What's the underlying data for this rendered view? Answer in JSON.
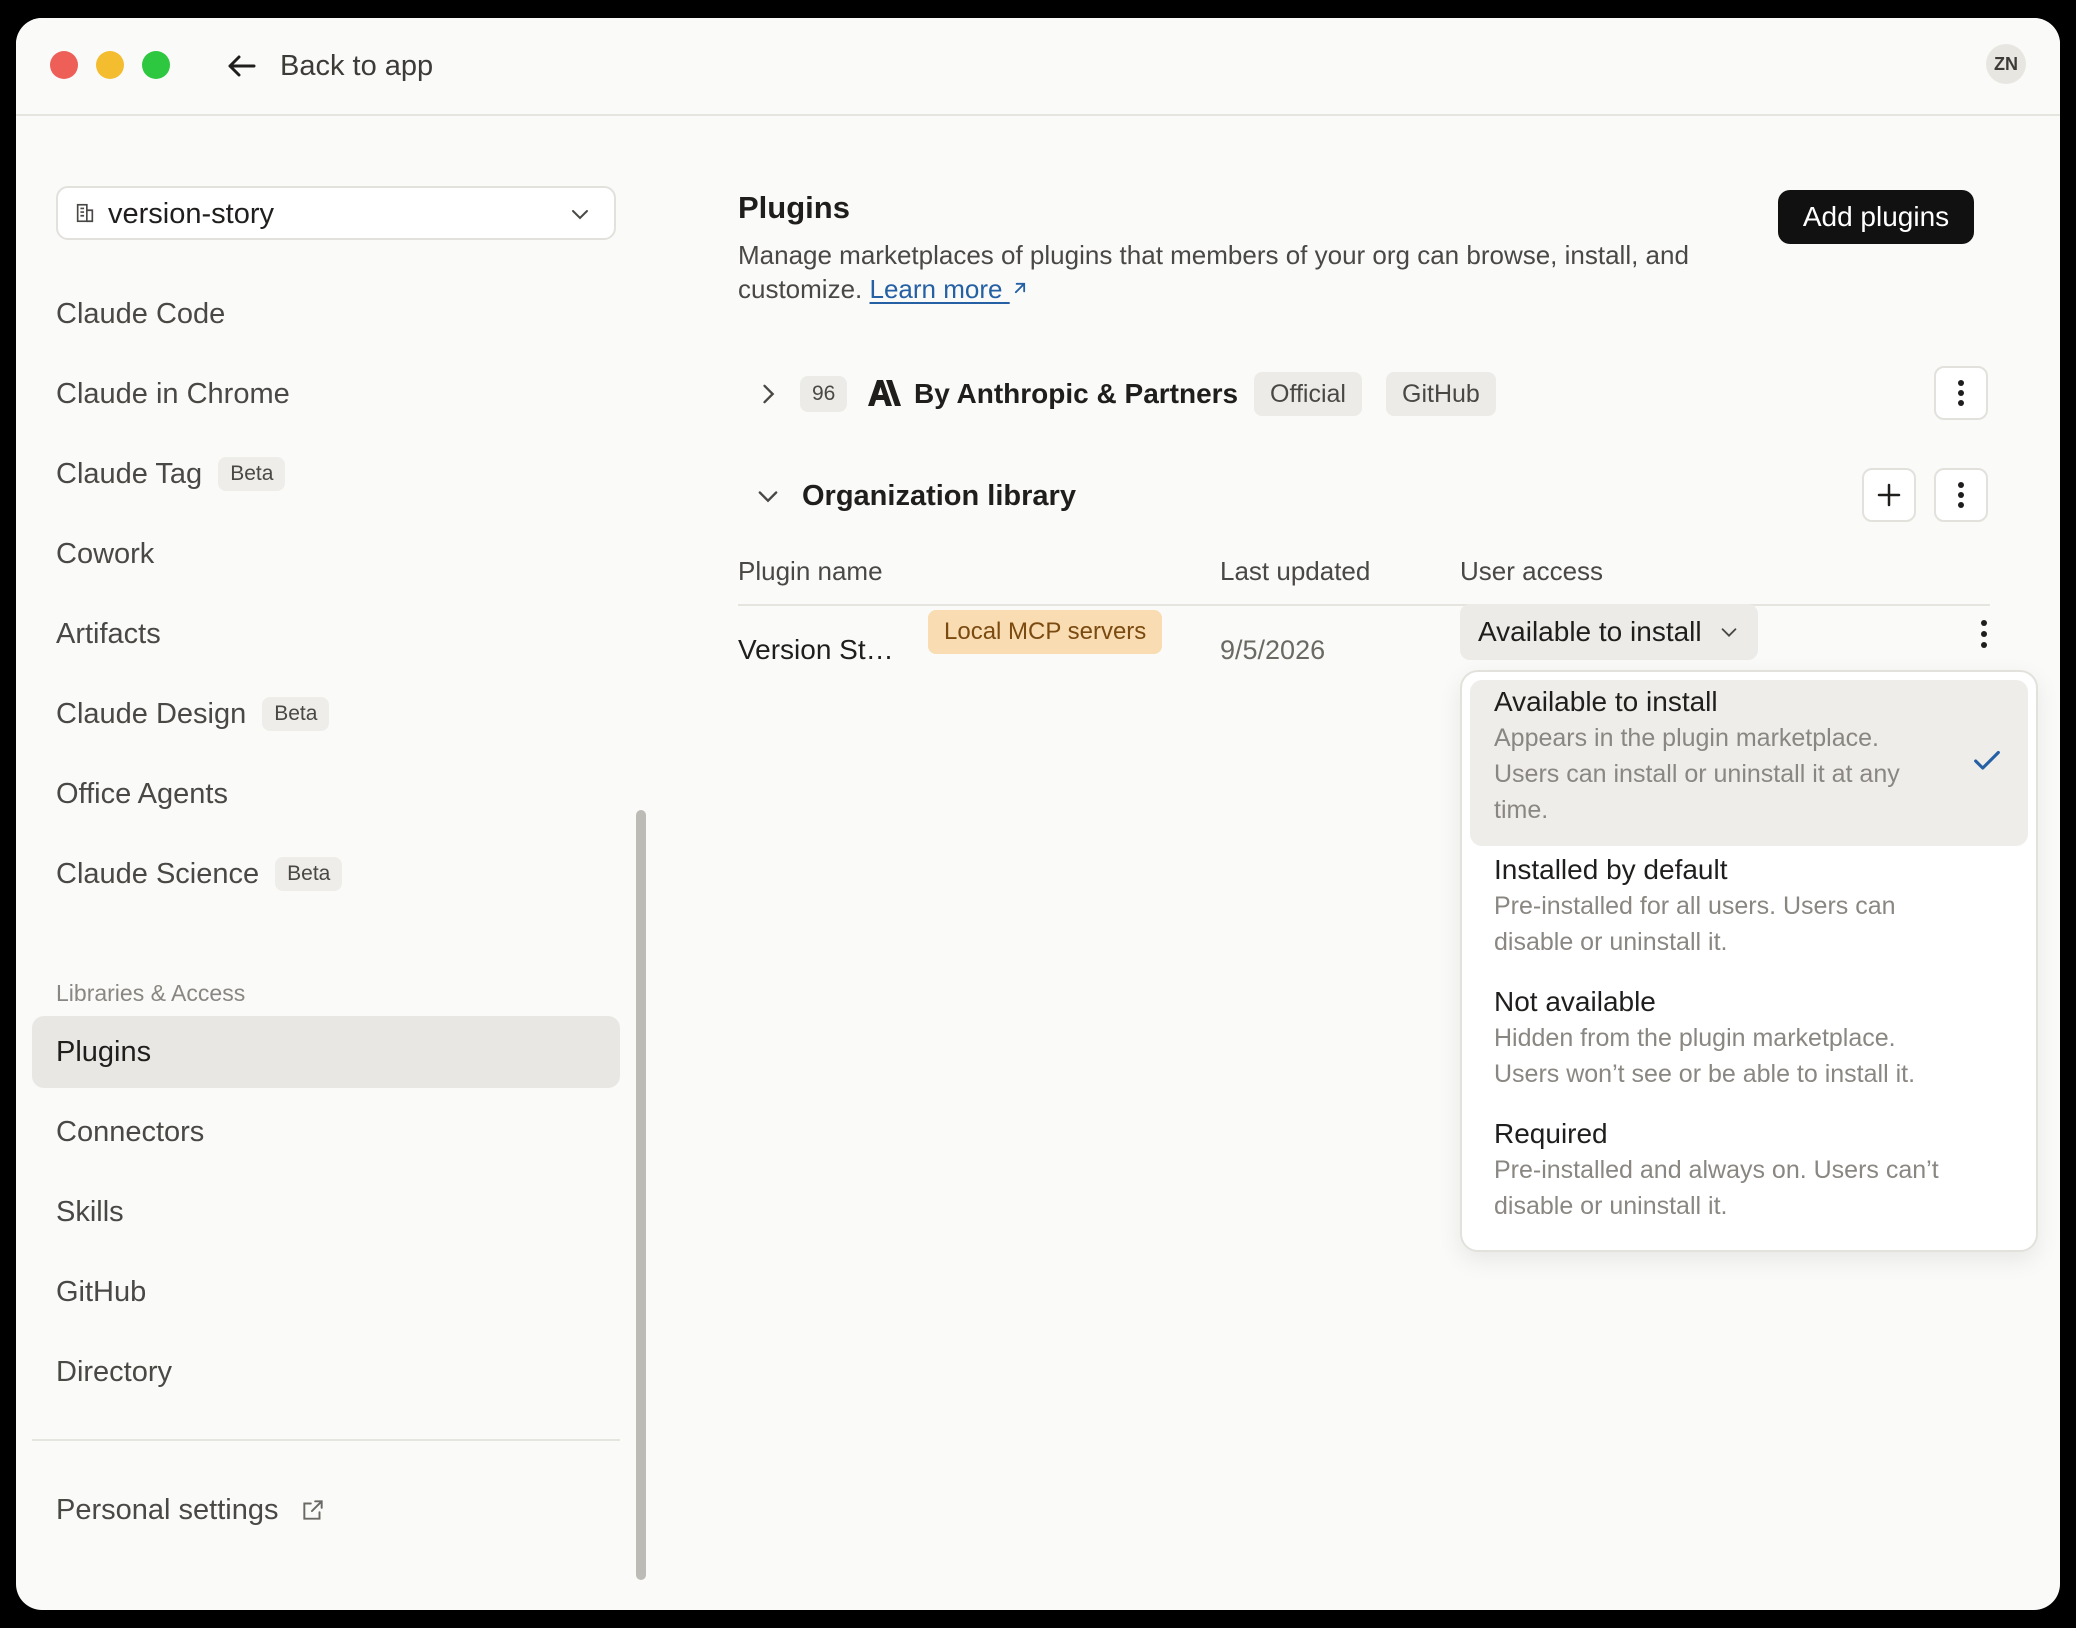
{
  "titlebar": {
    "back_label": "Back to app",
    "avatar_initials": "ZN"
  },
  "sidebar": {
    "org_name": "version-story",
    "items": [
      {
        "label": "Claude Code",
        "badge": ""
      },
      {
        "label": "Claude in Chrome",
        "badge": ""
      },
      {
        "label": "Claude Tag",
        "badge": "Beta"
      },
      {
        "label": "Cowork",
        "badge": ""
      },
      {
        "label": "Artifacts",
        "badge": ""
      },
      {
        "label": "Claude Design",
        "badge": "Beta"
      },
      {
        "label": "Office Agents",
        "badge": ""
      },
      {
        "label": "Claude Science",
        "badge": "Beta"
      }
    ],
    "section_label": "Libraries & Access",
    "library_items": [
      {
        "label": "Plugins",
        "active": true
      },
      {
        "label": "Connectors",
        "active": false
      },
      {
        "label": "Skills",
        "active": false
      },
      {
        "label": "GitHub",
        "active": false
      },
      {
        "label": "Directory",
        "active": false
      }
    ],
    "personal_settings": "Personal settings"
  },
  "main": {
    "title": "Plugins",
    "description": "Manage marketplaces of plugins that members of your org can browse, install, and customize.",
    "learn_more": "Learn more",
    "add_plugins": "Add plugins",
    "marketplace": {
      "count": "96",
      "name": "By Anthropic & Partners",
      "tags": [
        "Official",
        "GitHub"
      ]
    },
    "org_library": {
      "title": "Organization library",
      "columns": [
        "Plugin name",
        "Last updated",
        "User access"
      ],
      "rows": [
        {
          "name": "Version St…",
          "tag": "Local MCP servers",
          "last_updated": "9/5/2026",
          "access": "Available to install"
        }
      ]
    }
  },
  "dropdown": {
    "options": [
      {
        "title": "Available to install",
        "desc_lines": [
          "Appears in the plugin marketplace.",
          "Users can install or uninstall it at any",
          "time."
        ],
        "selected": true
      },
      {
        "title": "Installed by default",
        "desc_lines": [
          "Pre-installed for all users. Users can",
          "disable or uninstall it."
        ],
        "selected": false
      },
      {
        "title": "Not available",
        "desc_lines": [
          "Hidden from the plugin marketplace.",
          "Users won’t see or be able to install it."
        ],
        "selected": false
      },
      {
        "title": "Required",
        "desc_lines": [
          "Pre-installed and always on. Users can’t",
          "disable or uninstall it."
        ],
        "selected": false
      }
    ]
  },
  "colors": {
    "accent_link": "#2660a4",
    "mcp_tag_bg": "#f9dcb1",
    "active_nav_bg": "#e8e7e4"
  }
}
